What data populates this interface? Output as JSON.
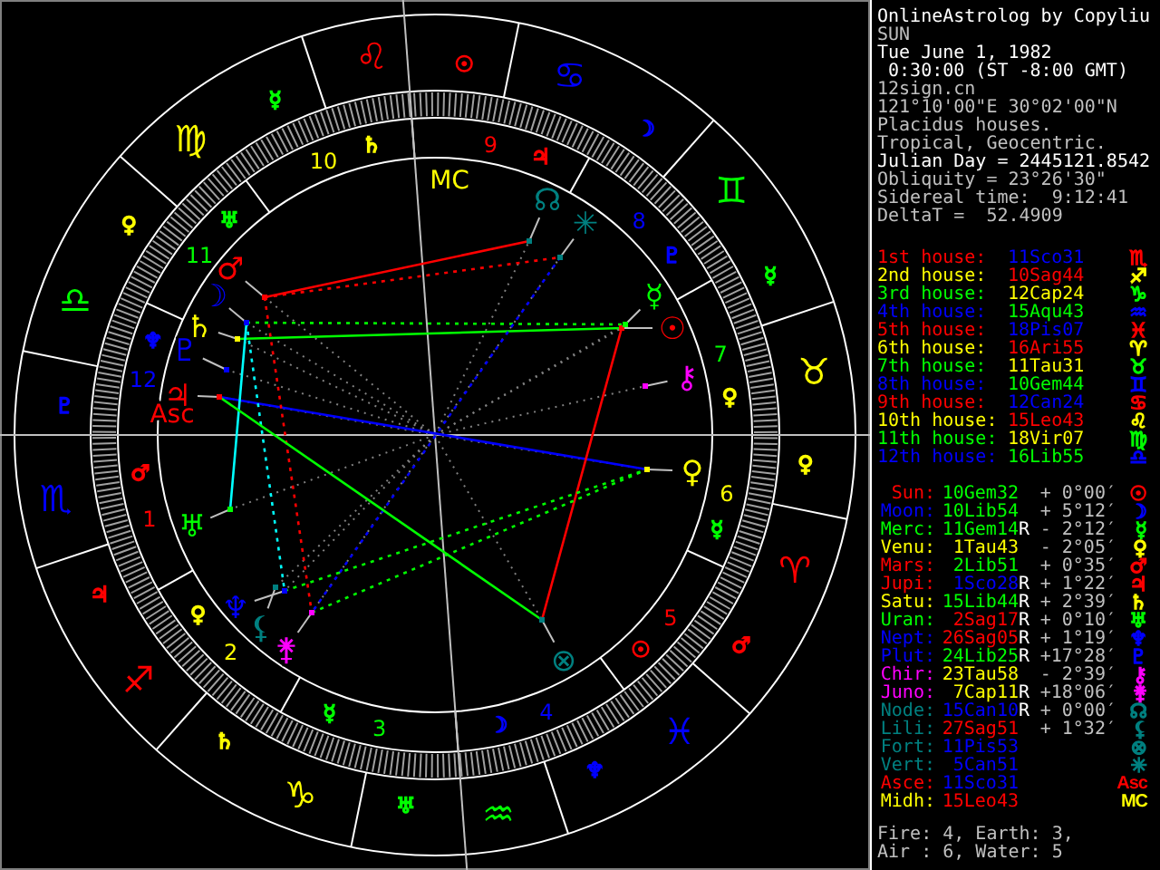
{
  "chart": {
    "signs": [
      {
        "glyph": "♈",
        "color": "#ff0000",
        "ruler": {
          "glyph": "♂",
          "color": "#ff0000"
        }
      },
      {
        "glyph": "♉",
        "color": "#ffff00",
        "ruler": {
          "glyph": "♀",
          "color": "#ffff00"
        }
      },
      {
        "glyph": "♊",
        "color": "#00ff00",
        "ruler": {
          "glyph": "☿",
          "color": "#00ff00"
        }
      },
      {
        "glyph": "♋",
        "color": "#0000ff",
        "ruler": {
          "glyph": "☽",
          "color": "#0000ff"
        }
      },
      {
        "glyph": "♌",
        "color": "#ff0000",
        "ruler": {
          "glyph": "☉",
          "color": "#ff0000"
        }
      },
      {
        "glyph": "♍",
        "color": "#ffff00",
        "ruler": {
          "glyph": "☿",
          "color": "#00ff00"
        }
      },
      {
        "glyph": "♎",
        "color": "#00ff00",
        "ruler": {
          "glyph": "♀",
          "color": "#ffff00"
        }
      },
      {
        "glyph": "♏",
        "color": "#0000ff",
        "ruler": {
          "glyph": "♇",
          "color": "#0000ff"
        }
      },
      {
        "glyph": "♐",
        "color": "#ff0000",
        "ruler": {
          "glyph": "♃",
          "color": "#ff0000"
        }
      },
      {
        "glyph": "♑",
        "color": "#ffff00",
        "ruler": {
          "glyph": "♄",
          "color": "#ffff00"
        }
      },
      {
        "glyph": "♒",
        "color": "#00ff00",
        "ruler": {
          "glyph": "♅",
          "color": "#00ff00"
        }
      },
      {
        "glyph": "♓",
        "color": "#0000ff",
        "ruler": {
          "glyph": "♆",
          "color": "#0000ff"
        }
      }
    ],
    "houses": [
      {
        "number": "1",
        "color": "#ff0000",
        "ruler": {
          "glyph": "♂",
          "color": "#ff0000"
        }
      },
      {
        "number": "2",
        "color": "#ffff00",
        "ruler": {
          "glyph": "♀",
          "color": "#ffff00"
        }
      },
      {
        "number": "3",
        "color": "#00ff00",
        "ruler": {
          "glyph": "☿",
          "color": "#00ff00"
        }
      },
      {
        "number": "4",
        "color": "#0000ff",
        "ruler": {
          "glyph": "☽",
          "color": "#0000ff"
        }
      },
      {
        "number": "5",
        "color": "#ff0000",
        "ruler": {
          "glyph": "☉",
          "color": "#ff0000"
        }
      },
      {
        "number": "6",
        "color": "#ffff00",
        "ruler": {
          "glyph": "☿",
          "color": "#00ff00"
        }
      },
      {
        "number": "7",
        "color": "#00ff00",
        "ruler": {
          "glyph": "♀",
          "color": "#ffff00"
        }
      },
      {
        "number": "8",
        "color": "#0000ff",
        "ruler": {
          "glyph": "♇",
          "color": "#0000ff"
        }
      },
      {
        "number": "9",
        "color": "#ff0000",
        "ruler": {
          "glyph": "♃",
          "color": "#ff0000"
        }
      },
      {
        "number": "10",
        "color": "#ffff00",
        "ruler": {
          "glyph": "♄",
          "color": "#ffff00"
        }
      },
      {
        "number": "11",
        "color": "#00ff00",
        "ruler": {
          "glyph": "♅",
          "color": "#00ff00"
        }
      },
      {
        "number": "12",
        "color": "#0000ff",
        "ruler": {
          "glyph": "♆",
          "color": "#0000ff"
        }
      }
    ],
    "angles": [
      {
        "label": "Asc",
        "color": "#ff0000"
      },
      {
        "label": "MC",
        "color": "#ffff00"
      }
    ],
    "planets": [
      {
        "glyph": "☉",
        "color": "#ff0000"
      },
      {
        "glyph": "☽",
        "color": "#0000ff"
      },
      {
        "glyph": "☿",
        "color": "#00ff00"
      },
      {
        "glyph": "♀",
        "color": "#ffff00"
      },
      {
        "glyph": "♂",
        "color": "#ff0000"
      },
      {
        "glyph": "♃",
        "color": "#ff0000"
      },
      {
        "glyph": "♄",
        "color": "#ffff00"
      },
      {
        "glyph": "♅",
        "color": "#00ff00"
      },
      {
        "glyph": "♆",
        "color": "#0000ff"
      },
      {
        "glyph": "♇",
        "color": "#0000ff"
      },
      {
        "glyph": "⚷",
        "color": "#ff00ff"
      },
      {
        "glyph": "⚵",
        "color": "#ff00ff"
      },
      {
        "glyph": "☊",
        "color": "#008080"
      },
      {
        "glyph": "⚸",
        "color": "#008080"
      },
      {
        "glyph": "⊗",
        "color": "#008080"
      },
      {
        "glyph": "✳",
        "color": "#008080"
      }
    ]
  },
  "info": [
    {
      "text": "OnlineAstrolog by Copyliu",
      "color": "#ffffff"
    },
    {
      "text": "SUN",
      "color": "#c0c0c0"
    },
    {
      "text": "Tue June 1, 1982",
      "color": "#ffffff"
    },
    {
      "text": " 0:30:00 (ST -8:00 GMT)",
      "color": "#ffffff"
    },
    {
      "text": "12sign.cn",
      "color": "#c0c0c0"
    },
    {
      "text": "121°10'00\"E 30°02'00\"N",
      "color": "#c0c0c0"
    },
    {
      "text": "Placidus houses.",
      "color": "#c0c0c0"
    },
    {
      "text": "Tropical, Geocentric.",
      "color": "#c0c0c0"
    },
    {
      "text": "Julian Day = 2445121.8542",
      "color": "#ffffff"
    },
    {
      "text": "Obliquity = 23°26'30\"",
      "color": "#c0c0c0"
    },
    {
      "text": "Sidereal time:  9:12:41",
      "color": "#c0c0c0"
    },
    {
      "text": "DeltaT =  52.4909",
      "color": "#c0c0c0"
    }
  ],
  "house_table": [
    {
      "label": {
        "text": "1st house:",
        "color": "#ff0000"
      },
      "position": {
        "text": "11Sco31",
        "color": "#0000ff"
      },
      "glyph": {
        "text": "♏",
        "color": "#ff0000"
      }
    },
    {
      "label": {
        "text": "2nd house:",
        "color": "#ffff00"
      },
      "position": {
        "text": "10Sag44",
        "color": "#ff0000"
      },
      "glyph": {
        "text": "♐",
        "color": "#ffff00"
      }
    },
    {
      "label": {
        "text": "3rd house:",
        "color": "#00ff00"
      },
      "position": {
        "text": "12Cap24",
        "color": "#ffff00"
      },
      "glyph": {
        "text": "♑",
        "color": "#00ff00"
      }
    },
    {
      "label": {
        "text": "4th house:",
        "color": "#0000ff"
      },
      "position": {
        "text": "15Aqu43",
        "color": "#00ff00"
      },
      "glyph": {
        "text": "♒",
        "color": "#0000ff"
      }
    },
    {
      "label": {
        "text": "5th house:",
        "color": "#ff0000"
      },
      "position": {
        "text": "18Pis07",
        "color": "#0000ff"
      },
      "glyph": {
        "text": "♓",
        "color": "#ff0000"
      }
    },
    {
      "label": {
        "text": "6th house:",
        "color": "#ffff00"
      },
      "position": {
        "text": "16Ari55",
        "color": "#ff0000"
      },
      "glyph": {
        "text": "♈",
        "color": "#ffff00"
      }
    },
    {
      "label": {
        "text": "7th house:",
        "color": "#00ff00"
      },
      "position": {
        "text": "11Tau31",
        "color": "#ffff00"
      },
      "glyph": {
        "text": "♉",
        "color": "#00ff00"
      }
    },
    {
      "label": {
        "text": "8th house:",
        "color": "#0000ff"
      },
      "position": {
        "text": "10Gem44",
        "color": "#00ff00"
      },
      "glyph": {
        "text": "♊",
        "color": "#0000ff"
      }
    },
    {
      "label": {
        "text": "9th house:",
        "color": "#ff0000"
      },
      "position": {
        "text": "12Can24",
        "color": "#0000ff"
      },
      "glyph": {
        "text": "♋",
        "color": "#ff0000"
      }
    },
    {
      "label": {
        "text": "10th house:",
        "color": "#ffff00"
      },
      "position": {
        "text": "15Leo43",
        "color": "#ff0000"
      },
      "glyph": {
        "text": "♌",
        "color": "#ffff00"
      }
    },
    {
      "label": {
        "text": "11th house:",
        "color": "#00ff00"
      },
      "position": {
        "text": "18Vir07",
        "color": "#ffff00"
      },
      "glyph": {
        "text": "♍",
        "color": "#00ff00"
      }
    },
    {
      "label": {
        "text": "12th house:",
        "color": "#0000ff"
      },
      "position": {
        "text": "16Lib55",
        "color": "#00ff00"
      },
      "glyph": {
        "text": "♎",
        "color": "#0000ff"
      }
    }
  ],
  "planet_table": [
    {
      "name": {
        "text": "Sun:",
        "color": "#ff0000"
      },
      "position": {
        "text": "10Gem32",
        "color": "#00ff00"
      },
      "latitude": "+ 0°00′",
      "glyph": {
        "text": "☉",
        "color": "#ff0000"
      }
    },
    {
      "name": {
        "text": "Moon:",
        "color": "#0000ff"
      },
      "position": {
        "text": "10Lib54",
        "color": "#00ff00"
      },
      "latitude": "+ 5°12′",
      "glyph": {
        "text": "☽",
        "color": "#0000ff"
      }
    },
    {
      "name": {
        "text": "Merc:",
        "color": "#00ff00"
      },
      "position": {
        "text": "11Gem14",
        "color": "#00ff00"
      },
      "retro": "R",
      "latitude": "- 2°12′",
      "glyph": {
        "text": "☿",
        "color": "#00ff00"
      }
    },
    {
      "name": {
        "text": "Venu:",
        "color": "#ffff00"
      },
      "position": {
        "text": "1Tau43",
        "color": "#ffff00"
      },
      "latitude": "- 2°05′",
      "glyph": {
        "text": "♀",
        "color": "#ffff00"
      }
    },
    {
      "name": {
        "text": "Mars:",
        "color": "#ff0000"
      },
      "position": {
        "text": "2Lib51",
        "color": "#00ff00"
      },
      "latitude": "+ 0°35′",
      "glyph": {
        "text": "♂",
        "color": "#ff0000"
      }
    },
    {
      "name": {
        "text": "Jupi:",
        "color": "#ff0000"
      },
      "position": {
        "text": "1Sco28",
        "color": "#0000ff"
      },
      "retro": "R",
      "latitude": "+ 1°22′",
      "glyph": {
        "text": "♃",
        "color": "#ff0000"
      }
    },
    {
      "name": {
        "text": "Satu:",
        "color": "#ffff00"
      },
      "position": {
        "text": "15Lib44",
        "color": "#00ff00"
      },
      "retro": "R",
      "latitude": "+ 2°39′",
      "glyph": {
        "text": "♄",
        "color": "#ffff00"
      }
    },
    {
      "name": {
        "text": "Uran:",
        "color": "#00ff00"
      },
      "position": {
        "text": "2Sag17",
        "color": "#ff0000"
      },
      "retro": "R",
      "latitude": "+ 0°10′",
      "glyph": {
        "text": "♅",
        "color": "#00ff00"
      }
    },
    {
      "name": {
        "text": "Nept:",
        "color": "#0000ff"
      },
      "position": {
        "text": "26Sag05",
        "color": "#ff0000"
      },
      "retro": "R",
      "latitude": "+ 1°19′",
      "glyph": {
        "text": "♆",
        "color": "#0000ff"
      }
    },
    {
      "name": {
        "text": "Plut:",
        "color": "#0000ff"
      },
      "position": {
        "text": "24Lib25",
        "color": "#00ff00"
      },
      "retro": "R",
      "latitude": "+17°28′",
      "glyph": {
        "text": "♇",
        "color": "#0000ff"
      }
    },
    {
      "name": {
        "text": "Chir:",
        "color": "#ff00ff"
      },
      "position": {
        "text": "23Tau58",
        "color": "#ffff00"
      },
      "latitude": "- 2°39′",
      "glyph": {
        "text": "⚷",
        "color": "#ff00ff"
      }
    },
    {
      "name": {
        "text": "Juno:",
        "color": "#ff00ff"
      },
      "position": {
        "text": "7Cap11",
        "color": "#ffff00"
      },
      "retro": "R",
      "latitude": "+18°06′",
      "glyph": {
        "text": "⚵",
        "color": "#ff00ff"
      }
    },
    {
      "name": {
        "text": "Node:",
        "color": "#008080"
      },
      "position": {
        "text": "15Can10",
        "color": "#0000ff"
      },
      "retro": "R",
      "latitude": "+ 0°00′",
      "glyph": {
        "text": "☊",
        "color": "#008080"
      }
    },
    {
      "name": {
        "text": "Lili:",
        "color": "#008080"
      },
      "position": {
        "text": "27Sag51",
        "color": "#ff0000"
      },
      "latitude": "+ 1°32′",
      "glyph": {
        "text": "⚸",
        "color": "#008080"
      }
    },
    {
      "name": {
        "text": "Fort:",
        "color": "#008080"
      },
      "position": {
        "text": "11Pis53",
        "color": "#0000ff"
      },
      "glyph": {
        "text": "⊗",
        "color": "#008080"
      }
    },
    {
      "name": {
        "text": "Vert:",
        "color": "#008080"
      },
      "position": {
        "text": "5Can51",
        "color": "#0000ff"
      },
      "glyph": {
        "text": "✳",
        "color": "#008080"
      }
    },
    {
      "name": {
        "text": "Asce:",
        "color": "#ff0000"
      },
      "position": {
        "text": "11Sco31",
        "color": "#0000ff"
      },
      "glyph": {
        "text": "Asc",
        "color": "#ff0000"
      }
    },
    {
      "name": {
        "text": "Midh:",
        "color": "#ffff00"
      },
      "position": {
        "text": "15Leo43",
        "color": "#ff0000"
      },
      "glyph": {
        "text": "MC",
        "color": "#ffff00"
      }
    }
  ],
  "elements": [
    "Fire: 4, Earth: 3,",
    "Air : 6, Water: 5"
  ]
}
